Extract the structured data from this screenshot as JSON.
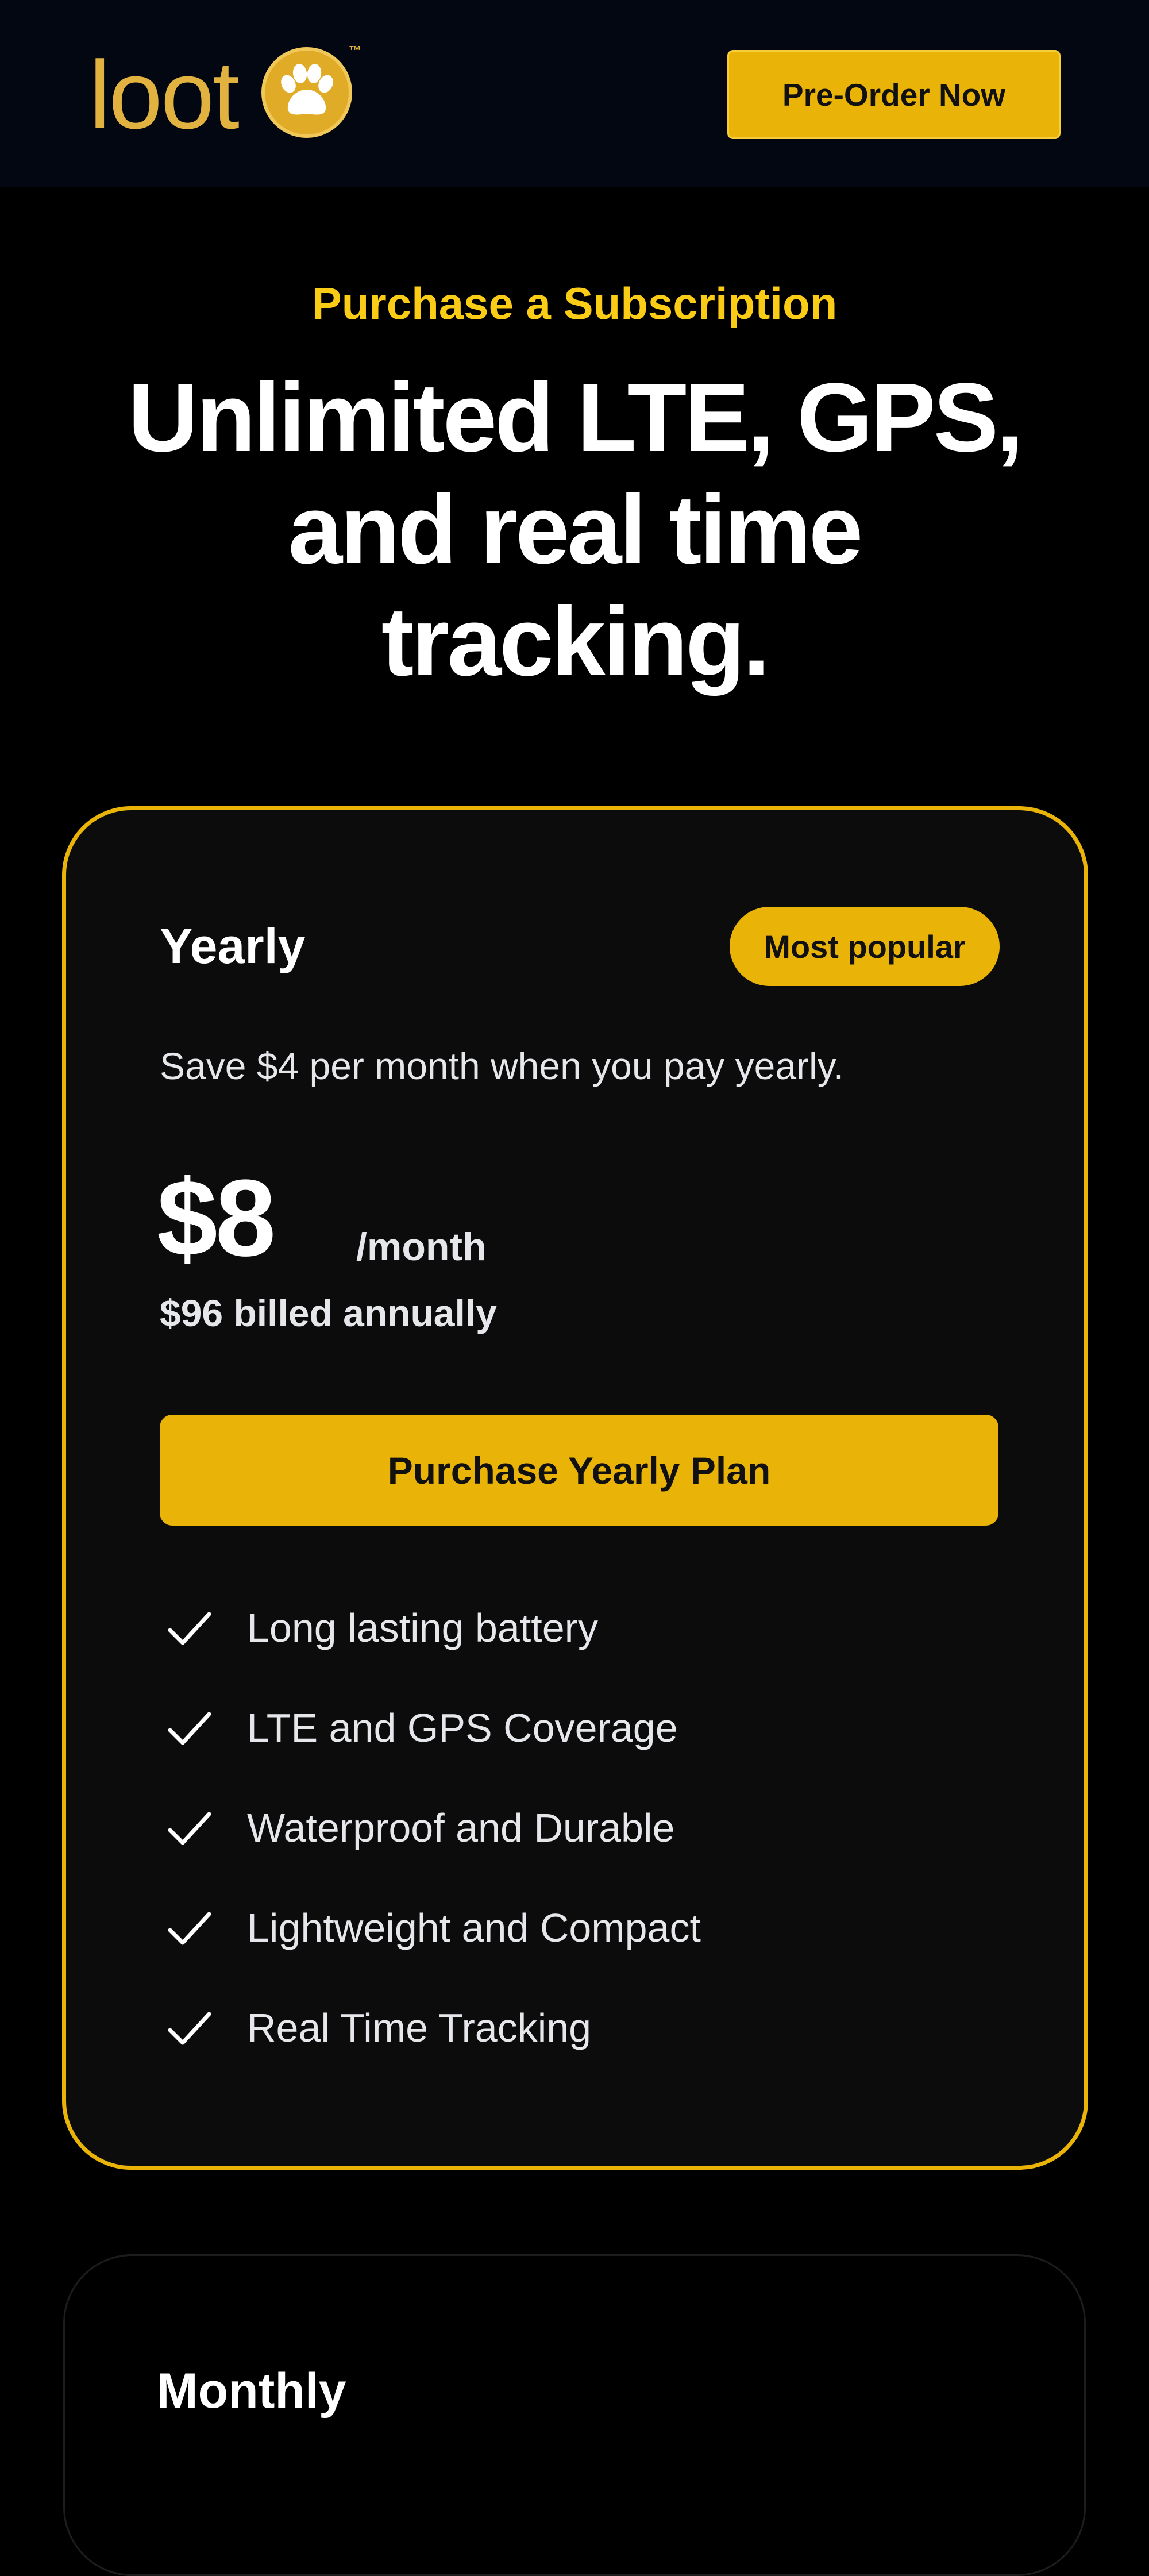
{
  "header": {
    "logo_text": "loot",
    "logo_trademark": "™",
    "logo_icon": "paw-icon",
    "cta_label": "Pre-Order Now"
  },
  "hero": {
    "eyebrow": "Purchase a Subscription",
    "headline": "Unlimited LTE, GPS, and real time tracking."
  },
  "plans": [
    {
      "name": "Yearly",
      "badge": "Most popular",
      "description": "Save $4 per month when you pay yearly.",
      "price": "$8",
      "period": "/month",
      "billed": "$96 billed annually",
      "button_label": "Purchase Yearly Plan",
      "features": [
        "Long lasting battery",
        "LTE and GPS Coverage",
        "Waterproof and Durable",
        "Lightweight and Compact",
        "Real Time Tracking"
      ]
    },
    {
      "name": "Monthly"
    }
  ],
  "colors": {
    "accent": "#eab308",
    "eyebrow": "#facc15",
    "header_bg": "#030712",
    "page_bg": "#000000",
    "card_bg": "#0c0c0c"
  }
}
